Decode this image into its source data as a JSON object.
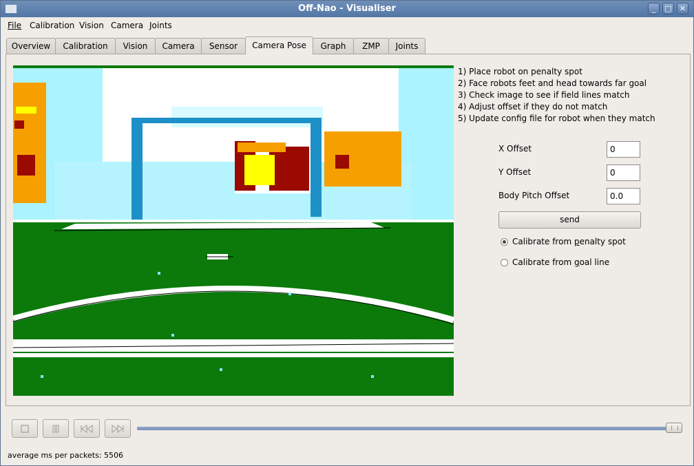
{
  "window": {
    "title": "Off-Nao - Visualiser"
  },
  "menu": [
    {
      "label": "File"
    },
    {
      "label": "Calibration"
    },
    {
      "label": "Vision"
    },
    {
      "label": "Camera"
    },
    {
      "label": "Joints"
    }
  ],
  "tabs": [
    {
      "label": "Overview"
    },
    {
      "label": "Calibration"
    },
    {
      "label": "Vision"
    },
    {
      "label": "Camera"
    },
    {
      "label": "Sensor"
    },
    {
      "label": "Camera Pose",
      "active": true
    },
    {
      "label": "Graph"
    },
    {
      "label": "ZMP"
    },
    {
      "label": "Joints"
    }
  ],
  "instructions": [
    "1) Place robot on penalty spot",
    "2) Face robots feet and head towards far goal",
    "3) Check image to see if field lines match",
    "4) Adjust offset if they do not match",
    "5) Update config file for robot when they match"
  ],
  "fields": {
    "x_offset": {
      "label": "X Offset",
      "value": "0"
    },
    "y_offset": {
      "label": "Y Offset",
      "value": "0"
    },
    "body_pitch": {
      "label": "Body Pitch Offset",
      "value": "0.0"
    }
  },
  "send_label": "send",
  "radios": {
    "penalty": {
      "label_pre": "Calibrate from ",
      "label_u": "p",
      "label_post": "enalty spot",
      "checked": true
    },
    "goal_line": {
      "label_pre": "Calibrate from ",
      "label_u": "g",
      "label_post": "oal line",
      "checked": false
    }
  },
  "playback": {
    "stop_icon": "stop-icon",
    "pause_icon": "pause-icon",
    "rewind_icon": "rewind-icon",
    "forward_icon": "fast-forward-icon",
    "position": 1.0
  },
  "status": "average ms per packets: 5506",
  "colors": {
    "field_green": "#0b7a0b",
    "field_white": "#ffffff",
    "goal_blue": "#1e90c8",
    "sky_cyan": "#9ff0ff",
    "orange": "#f5a000",
    "dark_red": "#9a0a00",
    "yellow": "#ffff00"
  }
}
